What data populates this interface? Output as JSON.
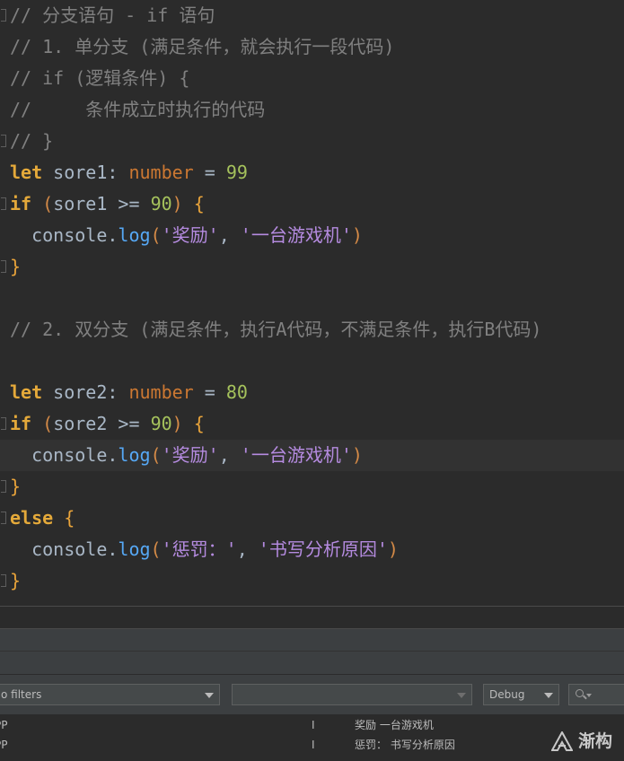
{
  "editor": {
    "comment1": "// 分支语句 - if 语句",
    "comment2": "// 1. 单分支 (满足条件，就会执行一段代码)",
    "comment3": "// if (逻辑条件) {",
    "comment4": "//     条件成立时执行的代码",
    "comment5": "// }",
    "let_kw": "let",
    "var1": " sore1",
    "colon": ": ",
    "type_number": "number",
    "eq": " = ",
    "val1": "99",
    "if_kw": "if",
    "cond_open": " (",
    "cond1": "sore1 >= ",
    "ninety": "90",
    "cond_close": ") ",
    "lbrace": "{",
    "rbrace": "}",
    "console": "  console.",
    "log_fn": "log",
    "lparen": "(",
    "rparen": ")",
    "str_reward": "'奖励'",
    "comma": ", ",
    "str_console_game": "'一台游戏机'",
    "comment6": "// 2. 双分支 (满足条件，执行A代码，不满足条件，执行B代码)",
    "var2": " sore2",
    "val2": "80",
    "cond2": "sore2 >= ",
    "else_kw": "else",
    "str_punish": "'惩罚：'",
    "str_reason": "'书写分析原因'"
  },
  "logcat": {
    "filters_placeholder": "o filters",
    "level": "Debug",
    "rows": [
      {
        "app": "PP",
        "level": "I",
        "message": "奖励 一台游戏机"
      },
      {
        "app": "PP",
        "level": "I",
        "message": "惩罚： 书写分析原因"
      }
    ]
  },
  "watermark": {
    "text": "渐构"
  }
}
